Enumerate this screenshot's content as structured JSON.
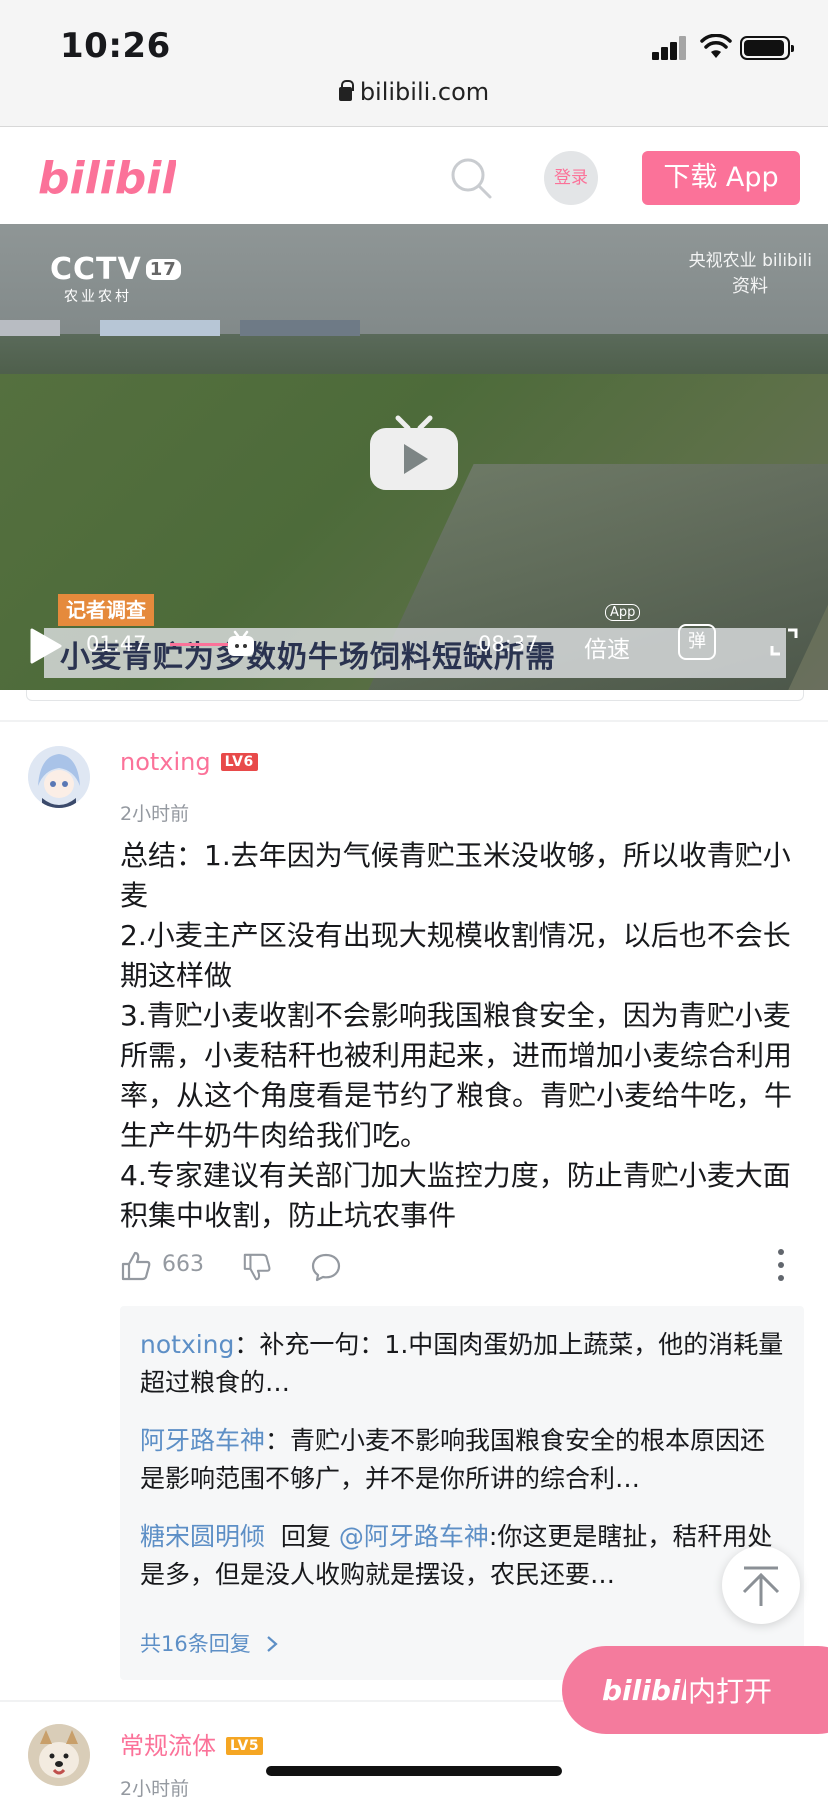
{
  "status_bar": {
    "time": "10:26",
    "url": "bilibili.com"
  },
  "header": {
    "logo_text": "bilibili",
    "login_label": "登录",
    "download_label": "下载 App"
  },
  "video": {
    "channel_logo": "CCTV",
    "channel_number": "17",
    "channel_sub": "农业农村",
    "watermark_top": "央视农业 bilibili",
    "watermark_sub": "资料",
    "reporter_tag": "记者调查",
    "caption": "小麦青贮为多数奶牛场饲料短缺所需",
    "current_time": "01:47",
    "total_time": "08:37",
    "speed_label": "倍速",
    "app_tag": "App",
    "danmaku_label": "弹",
    "progress": 0.207
  },
  "comment": {
    "username": "notxing",
    "level": "LV6",
    "time": "2小时前",
    "body": [
      "总结：1.去年因为气候青贮玉米没收够，所以收青贮小麦",
      "2.小麦主产区没有出现大规模收割情况，以后也不会长期这样做",
      "3.青贮小麦收割不会影响我国粮食安全，因为青贮小麦所需，小麦秸秆也被利用起来，进而增加小麦综合利用率，从这个角度看是节约了粮食。青贮小麦给牛吃，牛生产牛奶牛肉给我们吃。",
      "4.专家建议有关部门加大监控力度，防止青贮小麦大面积集中收割，防止坑农事件"
    ],
    "likes": "663",
    "replies": [
      {
        "user": "notxing",
        "sep": "：",
        "text": "补充一句：1.中国肉蛋奶加上蔬菜，他的消耗量超过粮食的…"
      },
      {
        "user": "阿牙路车神",
        "sep": "：",
        "text": "青贮小麦不影响我国粮食安全的根本原因还是影响范围不够广，并不是你所讲的综合利…"
      },
      {
        "user": "糖宋圆明倾",
        "reply_word": "回复",
        "at": "@阿牙路车神",
        "text": ":你这更是瞎扯，秸秆用处是多，但是没人收购就是摆设，农民还要…"
      }
    ],
    "more_replies": "共16条回复"
  },
  "open_in_app": {
    "logo_text": "bilibili",
    "label": "内打开"
  },
  "next_comment": {
    "username": "常规流体",
    "level": "LV5",
    "time": "2小时前"
  },
  "colors": {
    "brand_pink": "#fb7299",
    "link_blue": "#5d8fc6",
    "lv6": "#e84a4a",
    "lv5": "#f5a623"
  }
}
